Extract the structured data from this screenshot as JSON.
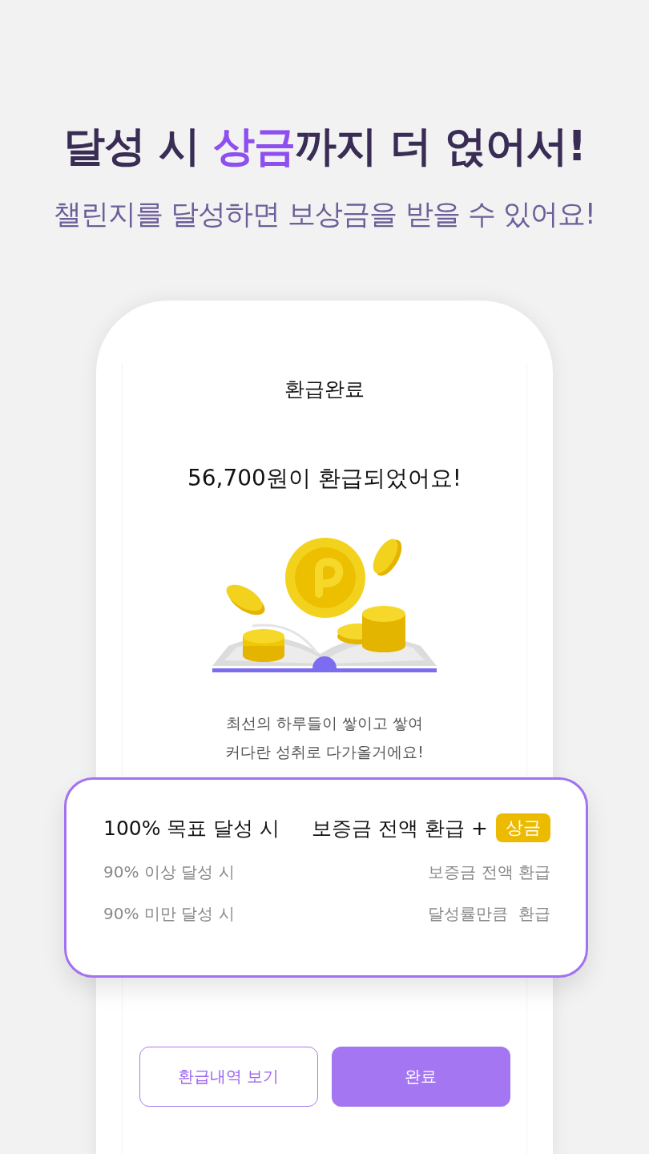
{
  "headline": [
    {
      "text": "달성 시 ",
      "accent": false
    },
    {
      "text": "상금",
      "accent": true
    },
    {
      "text": "까지 더 얹어서!",
      "accent": false
    }
  ],
  "subtitle": "챌린지를 달성하면 보상금을 받을 수 있어요!",
  "screen": {
    "title": "환급완료",
    "message": "56,700원이 환급되었어요!",
    "caption": "최선의 하루들이 쌓이고 쌓여\n커다란 성취로 다가올거에요!"
  },
  "reward_table": [
    {
      "condition": "100% 목표 달성 시",
      "reward": "보증금 전액 환급 +",
      "badge": "상금",
      "emphasis": true
    },
    {
      "condition": "90% 이상 달성 시",
      "reward": "보증금 전액 환급",
      "emphasis": false
    },
    {
      "condition": "90% 미만 달성 시",
      "reward": "달성률만큼  환급",
      "emphasis": false
    }
  ],
  "buttons": [
    {
      "label": "환급내역 보기",
      "kind": "outline"
    },
    {
      "label": "완료",
      "kind": "filled"
    }
  ]
}
